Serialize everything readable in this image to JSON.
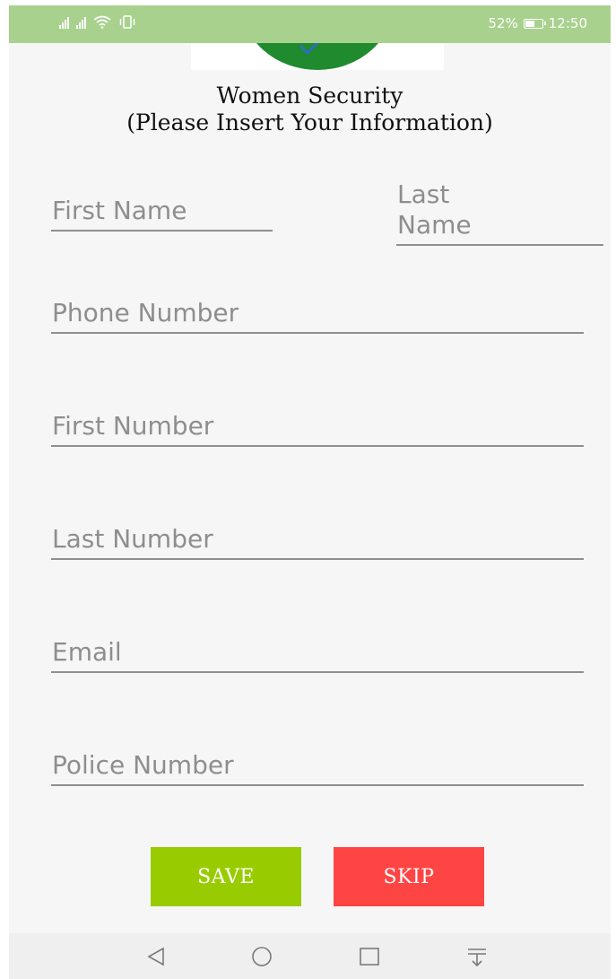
{
  "status_bar": {
    "battery_percent": "52%",
    "time": "12:50",
    "icons": [
      "signal-icon",
      "signal-icon",
      "wifi-icon",
      "vibrate-icon",
      "battery-icon"
    ],
    "background": "#a9d18e"
  },
  "header": {
    "title_line1": "Women Security",
    "title_line2": "(Please Insert Your Information)"
  },
  "form": {
    "first_name": {
      "placeholder": "First Name",
      "value": ""
    },
    "last_name": {
      "placeholder_line1": "Last",
      "placeholder_line2": "Name",
      "value": ""
    },
    "phone_number": {
      "placeholder": "Phone Number",
      "value": ""
    },
    "first_number": {
      "placeholder": "First Number",
      "value": ""
    },
    "last_number": {
      "placeholder": "Last Number",
      "value": ""
    },
    "email": {
      "placeholder": "Email",
      "value": ""
    },
    "police_number": {
      "placeholder": "Police Number",
      "value": ""
    }
  },
  "actions": {
    "save_label": "SAVE",
    "skip_label": "SKIP",
    "save_color": "#99cc00",
    "skip_color": "#ff4444"
  },
  "nav_bar": {
    "icons": [
      "back-icon",
      "home-icon",
      "recents-icon",
      "notification-pull-icon"
    ]
  }
}
